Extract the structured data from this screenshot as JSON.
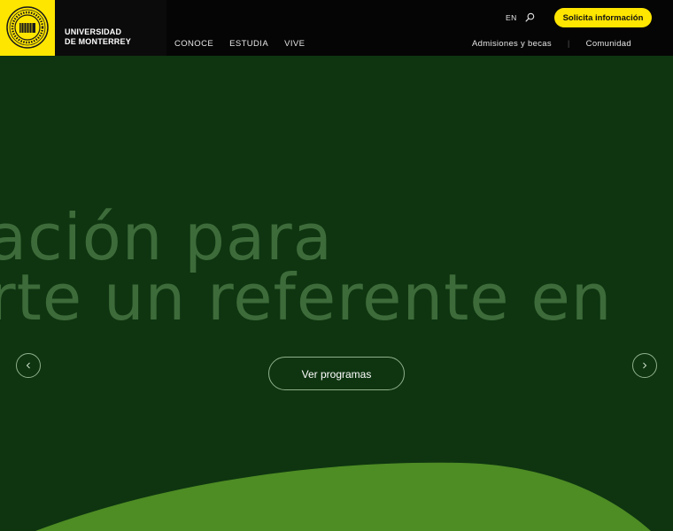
{
  "header": {
    "brand": {
      "line1": "UNIVERSIDAD",
      "line2": "DE MONTERREY"
    },
    "nav": [
      {
        "label": "CONOCE"
      },
      {
        "label": "ESTUDIA"
      },
      {
        "label": "VIVE"
      }
    ],
    "secondary_nav": [
      {
        "label": "Admisiones y becas"
      },
      {
        "label": "Comunidad"
      }
    ],
    "separator": "|",
    "lang": "EN",
    "cta_label": "Solicita información"
  },
  "hero": {
    "line1": "ación para",
    "line2": "rte un referente en",
    "button_label": "Ver programas",
    "prev_glyph": "‹",
    "next_glyph": "›"
  },
  "colors": {
    "brand_yellow": "#ffe600",
    "hero_bg": "#0e3510",
    "hero_text": "#3e6b3a",
    "wave_green": "#4e8c24"
  },
  "icons": {
    "logo": "university-seal-icon",
    "search": "search-icon",
    "prev": "chevron-left-icon",
    "next": "chevron-right-icon"
  }
}
